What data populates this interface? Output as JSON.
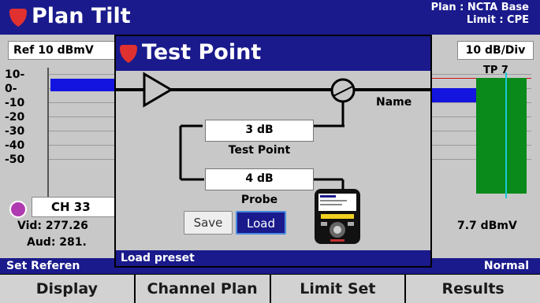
{
  "header": {
    "title": "Plan Tilt",
    "plan": "Plan : NCTA Base",
    "limit": "Limit : CPE"
  },
  "chart": {
    "reference": "Ref 10 dBmV",
    "scale": "10 dB/Div",
    "y_ticks": [
      "10-",
      "0-",
      "-10",
      "-20",
      "-30",
      "-40",
      "-50"
    ],
    "marker_label": "TP 7"
  },
  "channel": {
    "label": "CH 33",
    "video": "Vid: 277.26",
    "audio": "Aud: 281.",
    "level": "7.7 dBmV"
  },
  "status": {
    "left": "Set Referen",
    "right": "Normal"
  },
  "softkeys": [
    "Display",
    "Channel Plan",
    "Limit Set",
    "Results"
  ],
  "dialog": {
    "title": "Test Point",
    "test_point_value": "3 dB",
    "test_point_label": "Test Point",
    "probe_value": "4 dB",
    "probe_label": "Probe",
    "name_label": "Name",
    "save_label": "Save",
    "load_label": "Load",
    "footer": "Load preset"
  },
  "colors": {
    "header_bg": "#1a1a8c",
    "logo_red": "#e03030",
    "bar_blue": "#1414e0",
    "bar_green": "#0a8a1a",
    "marker_cyan": "#18c8d8"
  }
}
